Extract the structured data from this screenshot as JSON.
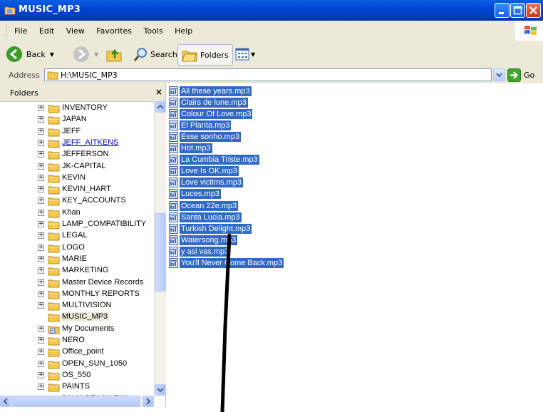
{
  "window": {
    "title": "MUSIC_MP3"
  },
  "menu": [
    "File",
    "Edit",
    "View",
    "Favorites",
    "Tools",
    "Help"
  ],
  "toolbar": {
    "back_label": "Back",
    "search_label": "Search",
    "folders_label": "Folders"
  },
  "address": {
    "label": "Address",
    "value": "H:\\MUSIC_MP3",
    "go_label": "Go"
  },
  "folders_pane": {
    "header": "Folders",
    "close_glyph": "×",
    "items": [
      {
        "label": "INVENTORY",
        "expander": "+"
      },
      {
        "label": "JAPAN",
        "expander": "+"
      },
      {
        "label": "JEFF",
        "expander": "+"
      },
      {
        "label": "JEFF_AITKENS",
        "expander": "+",
        "link": true
      },
      {
        "label": "JEFFERSON",
        "expander": "+"
      },
      {
        "label": "JK-CAPITAL",
        "expander": "+"
      },
      {
        "label": "KEVIN",
        "expander": "+"
      },
      {
        "label": "KEVIN_HART",
        "expander": "+"
      },
      {
        "label": "KEY_ACCOUNTS",
        "expander": "+"
      },
      {
        "label": "Khan",
        "expander": "+"
      },
      {
        "label": "LAMP_COMPATIBILITY",
        "expander": "+"
      },
      {
        "label": "LEGAL",
        "expander": "+"
      },
      {
        "label": "LOGO",
        "expander": "+"
      },
      {
        "label": "MARIE",
        "expander": "+"
      },
      {
        "label": "MARKETING",
        "expander": "+"
      },
      {
        "label": "Master Device Records",
        "expander": "+"
      },
      {
        "label": "MONTHLY REPORTS",
        "expander": "+"
      },
      {
        "label": "MULTIVISION",
        "expander": "+"
      },
      {
        "label": "MUSIC_MP3",
        "expander": "",
        "selected": true
      },
      {
        "label": "My Documents",
        "expander": "+",
        "special": true
      },
      {
        "label": "NERO",
        "expander": "+"
      },
      {
        "label": "Office_point",
        "expander": "+"
      },
      {
        "label": "OPEN_SUN_1050",
        "expander": "+"
      },
      {
        "label": "OS_550",
        "expander": "+"
      },
      {
        "label": "PAINTS",
        "expander": "+"
      },
      {
        "label": "PALM BEACH TAN",
        "expander": "+"
      }
    ]
  },
  "files": [
    "All these years.mp3",
    "Clairs de lune.mp3",
    "Colour Of Love.mp3",
    "El Planta.mp3",
    "Esse sonho.mp3",
    "Hot.mp3",
    "La Cumbia Triste.mp3",
    "Love Is OK.mp3",
    "Love victims.mp3",
    "Luces.mp3",
    "Ocean 22e.mp3",
    "Santa Lucia.mp3",
    "Turkish Delight.mp3",
    "Watersong.mp3",
    "y asi vas.mp3",
    "You'll Never Come Back.mp3"
  ],
  "colors": {
    "titlebar": "#0046d5",
    "selection": "#316ac5",
    "chrome": "#ece9d8"
  }
}
